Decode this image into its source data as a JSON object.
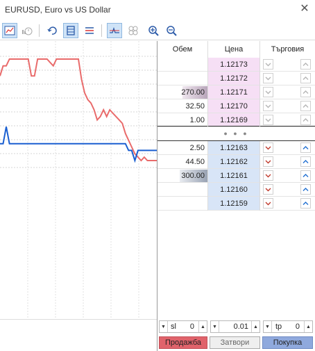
{
  "window": {
    "title": "EURUSD, Euro vs US Dollar",
    "close_symbol": "✕"
  },
  "toolbar": {
    "buttons": [
      {
        "icon": "chart-icon",
        "active": true
      },
      {
        "icon": "history-icon",
        "active": false
      },
      {
        "icon": "refresh-icon",
        "active": false
      },
      {
        "icon": "depth-icon",
        "active": true
      },
      {
        "icon": "levels-icon",
        "active": false
      },
      {
        "icon": "tick-chart-icon",
        "active": true
      },
      {
        "icon": "linked-icon",
        "active": false
      },
      {
        "icon": "zoom-in-icon",
        "active": false
      },
      {
        "icon": "zoom-out-icon",
        "active": false
      }
    ]
  },
  "depth": {
    "headers": {
      "volume": "Обем",
      "price": "Цена",
      "trading": "Търговия"
    },
    "sell_rows": [
      {
        "volume": "",
        "price": "1.12173",
        "bar": 0
      },
      {
        "volume": "",
        "price": "1.12172",
        "bar": 0
      },
      {
        "volume": "270.00",
        "price": "1.12171",
        "bar": 0.9
      },
      {
        "volume": "32.50",
        "price": "1.12170",
        "bar": 0
      },
      {
        "volume": "1.00",
        "price": "1.12169",
        "bar": 0
      }
    ],
    "spread_symbol": "● ● ●",
    "buy_rows": [
      {
        "volume": "2.50",
        "price": "1.12163",
        "bar": 0
      },
      {
        "volume": "44.50",
        "price": "1.12162",
        "bar": 0
      },
      {
        "volume": "300.00",
        "price": "1.12161",
        "bar": 1.0
      },
      {
        "volume": "",
        "price": "1.12160",
        "bar": 0
      },
      {
        "volume": "",
        "price": "1.12159",
        "bar": 0
      }
    ]
  },
  "controls": {
    "sl_label": "sl",
    "sl_value": "0",
    "volume_value": "0.01",
    "tp_label": "tp",
    "tp_value": "0",
    "sell_label": "Продажба",
    "close_label": "Затвори",
    "buy_label": "Покупка"
  },
  "colors": {
    "ask_line": "#e96b6b",
    "bid_line": "#1a5fd1",
    "sell_price_bg": "#f6dff5",
    "buy_price_bg": "#d8e5f7",
    "sell_arrow": "#c0392b",
    "buy_arrow": "#1f6fd1",
    "disabled_arrow": "#b5b5b5"
  },
  "chart_data": {
    "type": "line",
    "series": [
      {
        "values": [
          15,
          18,
          18,
          20,
          20,
          20,
          20,
          20,
          20,
          20,
          15,
          15,
          20,
          20,
          20,
          20,
          19,
          18,
          20,
          20,
          20,
          20,
          20,
          20,
          20,
          20,
          14,
          10,
          8,
          7,
          5,
          2,
          3,
          5,
          3,
          5,
          4,
          3,
          2,
          1,
          -2,
          -4,
          -6,
          -8,
          -9,
          -10,
          -9,
          -10,
          -10,
          -10,
          -10
        ]
      },
      {
        "values": [
          -5,
          -5,
          0,
          -5,
          -5,
          -5,
          -5,
          -5,
          -5,
          -5,
          -5,
          -5,
          -5,
          -5,
          -5,
          -5,
          -5,
          -5,
          -5,
          -5,
          -5,
          -5,
          -5,
          -5,
          -5,
          -5,
          -5,
          -5,
          -5,
          -5,
          -5,
          -5,
          -5,
          -5,
          -5,
          -5,
          -5,
          -5,
          -5,
          -5,
          -5,
          -7,
          -7,
          -10,
          -7,
          -7,
          -7,
          -7,
          -7,
          -7,
          -7
        ]
      }
    ]
  }
}
